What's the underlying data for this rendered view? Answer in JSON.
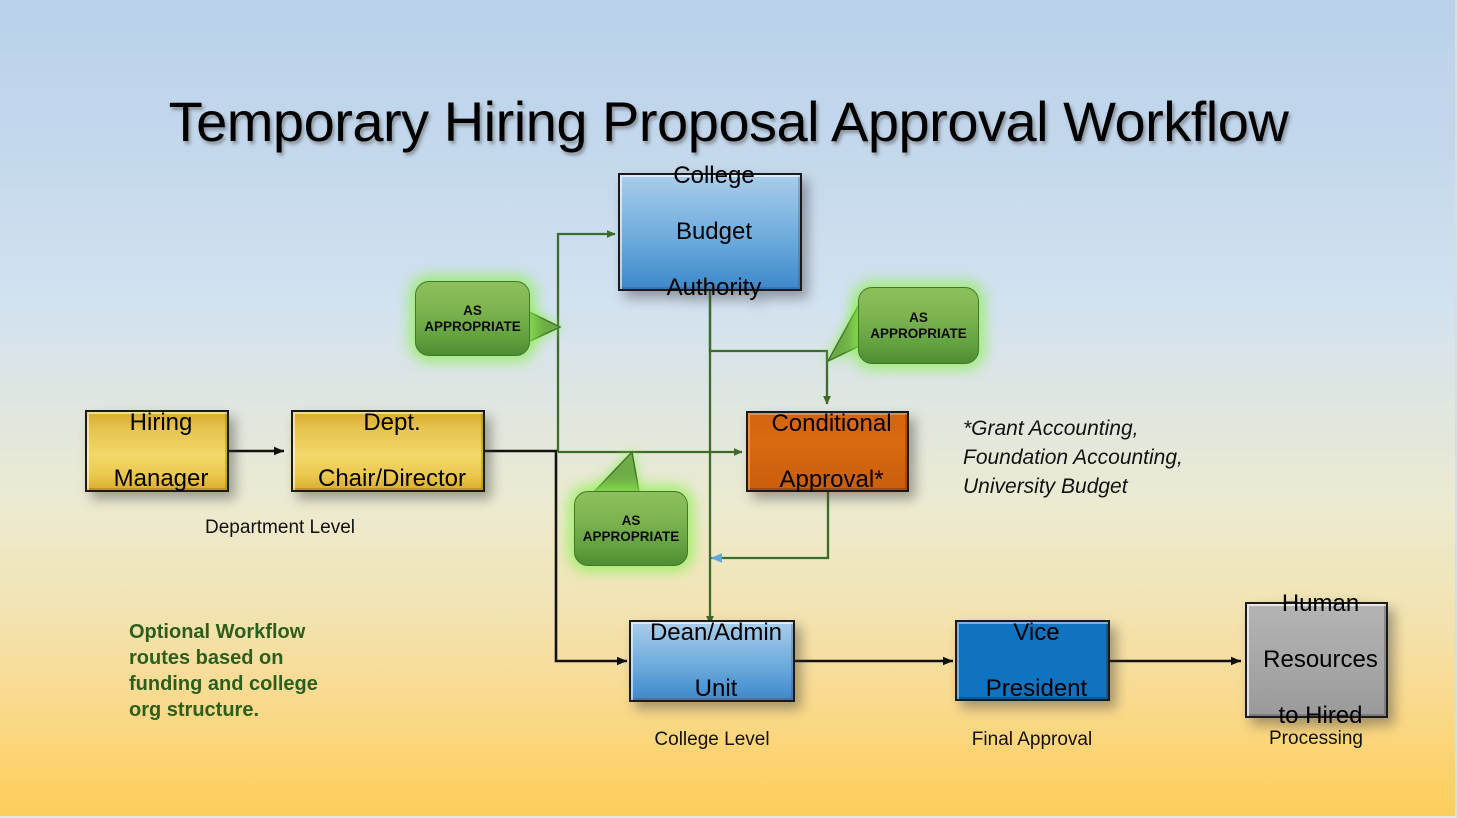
{
  "diagram": {
    "title": "Temporary Hiring Proposal Approval Workflow",
    "type": "flowchart",
    "colors": {
      "background_top": "#b9d2e9",
      "background_mid": "#e6e8d8",
      "background_bottom": "#fcce5e",
      "gold_node": "#f2d868",
      "blue_gradient_node": "#6aa9dc",
      "blue_solid_node": "#1173c0",
      "orange_node": "#d4650f",
      "gray_node": "#a9a9a9",
      "callout_green": "#7fb551",
      "callout_glow": "#8cf050",
      "optional_note_green": "#2c5e1e",
      "green_connector": "#3d6b2a",
      "black_connector": "#111111"
    },
    "nodes": [
      {
        "id": "hiring_manager",
        "label": "Hiring Manager",
        "style": "gold"
      },
      {
        "id": "dept_chair",
        "label": "Dept. Chair/Director",
        "style": "gold"
      },
      {
        "id": "college_budget",
        "label": "College Budget Authority",
        "style": "blue-gradient"
      },
      {
        "id": "conditional",
        "label": "Conditional Approval*",
        "style": "orange"
      },
      {
        "id": "dean_admin",
        "label": "Dean/Admin Unit",
        "style": "blue-gradient"
      },
      {
        "id": "vice_president",
        "label": "Vice President",
        "style": "blue-solid"
      },
      {
        "id": "human_resources",
        "label": "Human Resources to Hired",
        "style": "gray"
      }
    ],
    "node_text": {
      "hiring_manager": [
        "Hiring",
        "Manager"
      ],
      "dept_chair": [
        "Dept.",
        "Chair/Director"
      ],
      "college_budget": [
        "College",
        "Budget",
        "Authority"
      ],
      "conditional": [
        "Conditional",
        "Approval*"
      ],
      "dean_admin": [
        "Dean/Admin",
        "Unit"
      ],
      "vice_president": [
        "Vice",
        "President"
      ],
      "human_resources": [
        "Human",
        "Resources",
        "to Hired"
      ]
    },
    "captions": [
      {
        "id": "department_level",
        "text": "Department Level",
        "for": "dept_chair"
      },
      {
        "id": "college_level",
        "text": "College Level",
        "for": "dean_admin"
      },
      {
        "id": "final_approval",
        "text": "Final Approval",
        "for": "vice_president"
      },
      {
        "id": "processing",
        "text": "Processing",
        "for": "human_resources"
      }
    ],
    "callouts": [
      {
        "id": "callout_left",
        "line1": "AS",
        "line2": "APPROPRIATE",
        "tail": "right"
      },
      {
        "id": "callout_right",
        "line1": "AS",
        "line2": "APPROPRIATE",
        "tail": "down-left"
      },
      {
        "id": "callout_bottom",
        "line1": "AS",
        "line2": "APPROPRIATE",
        "tail": "up-right"
      }
    ],
    "notes": {
      "footnote": [
        "*Grant Accounting,",
        "Foundation Accounting,",
        "University Budget"
      ],
      "optional_workflow": [
        "Optional Workflow",
        "routes based on",
        "funding and college",
        "org structure."
      ]
    },
    "edges": [
      {
        "from": "hiring_manager",
        "to": "dept_chair",
        "color": "black"
      },
      {
        "from": "dept_chair",
        "to": "dean_admin",
        "color": "black"
      },
      {
        "from": "dept_chair",
        "to": "college_budget",
        "color": "green"
      },
      {
        "from": "dept_chair",
        "to": "conditional",
        "color": "green"
      },
      {
        "from": "college_budget",
        "to": "conditional",
        "color": "green"
      },
      {
        "from": "college_budget",
        "to": "dean_admin",
        "color": "green"
      },
      {
        "from": "conditional",
        "to": "dean_admin",
        "color": "green"
      },
      {
        "from": "dean_admin",
        "to": "vice_president",
        "color": "black"
      },
      {
        "from": "vice_president",
        "to": "human_resources",
        "color": "black"
      }
    ]
  }
}
